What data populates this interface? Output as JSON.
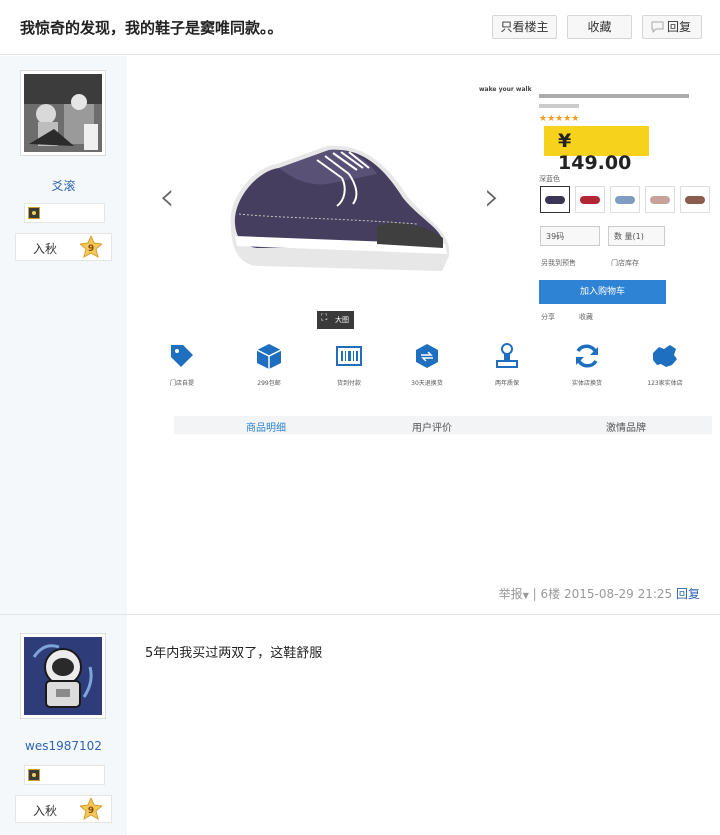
{
  "header": {
    "title": "我惊奇的发现，我的鞋子是窦唯同款。。",
    "only_op": "只看楼主",
    "favorite": "收藏",
    "reply": "回复"
  },
  "posts": [
    {
      "username": "爻滚",
      "rank": "入秋",
      "level": "9",
      "image": {
        "tagline": "wake your walk",
        "rating": "★★★★★",
        "price": "¥ 149.00",
        "color_label": "深蓝色",
        "size_select": "39码",
        "qty_select": "数 量(1)",
        "pickup": "另我到预售",
        "store": "门店库存",
        "add_cart": "加入购物车",
        "share": "分享",
        "collect": "收藏",
        "zoom": "大图",
        "features": [
          "门店自提",
          "299包邮",
          "货到付款",
          "30天退换货",
          "两年质保",
          "实体店换货",
          "123家实体店"
        ],
        "tabs": [
          "商品明细",
          "用户评价",
          "激情品牌"
        ]
      },
      "report": "举报",
      "floor": "6楼",
      "timestamp": "2015-08-29 21:25",
      "reply": "回复"
    },
    {
      "username": "wes1987102",
      "rank": "入秋",
      "level": "9",
      "text": "5年内我买过两双了，这鞋舒服"
    }
  ],
  "colors": {
    "accent": "#2d64b3",
    "price_tag": "#f6d21d",
    "cart": "#2f83d4",
    "sidebar": "#f5f8fb"
  }
}
